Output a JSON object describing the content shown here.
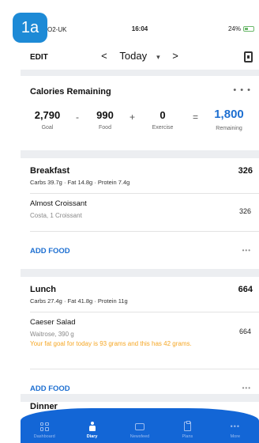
{
  "badge": "1a",
  "status": {
    "carrier": "O2-UK",
    "time": "16:04",
    "battery": "24%"
  },
  "nav": {
    "edit": "EDIT",
    "date": "Today",
    "prev": "<",
    "next": ">"
  },
  "calories": {
    "title": "Calories Remaining",
    "goal": "2,790",
    "goal_label": "Goal",
    "food": "990",
    "food_label": "Food",
    "exercise": "0",
    "exercise_label": "Exercise",
    "remaining": "1,800",
    "remaining_label": "Remaining",
    "minus": "-",
    "plus": "+",
    "equals": "="
  },
  "breakfast": {
    "name": "Breakfast",
    "total": "326",
    "macros": "Carbs 39.7g · Fat 14.8g · Protein 7.4g",
    "item_name": "Almost Croissant",
    "item_detail": "Costa, 1 Croissant",
    "item_cal": "326",
    "add": "ADD FOOD"
  },
  "lunch": {
    "name": "Lunch",
    "total": "664",
    "macros": "Carbs 27.4g · Fat 41.8g · Protein 11g",
    "item_name": "Caeser Salad",
    "item_detail": "Waitrose, 390 g",
    "item_cal": "664",
    "warning": "Your fat goal for today is 93 grams and this has 42 grams.",
    "add": "ADD FOOD"
  },
  "dinner": {
    "name": "Dinner"
  },
  "tabs": [
    {
      "label": "Dashboard",
      "icon": "grid-icon"
    },
    {
      "label": "Diary",
      "icon": "diary-icon"
    },
    {
      "label": "Newsfeed",
      "icon": "chat-icon"
    },
    {
      "label": "Plans",
      "icon": "clipboard-icon"
    },
    {
      "label": "More",
      "icon": "more-icon"
    }
  ],
  "colors": {
    "accent": "#1d6fd1",
    "tabbar": "#1366d6",
    "warning": "#f5a623",
    "badge": "#1d8ad6"
  }
}
